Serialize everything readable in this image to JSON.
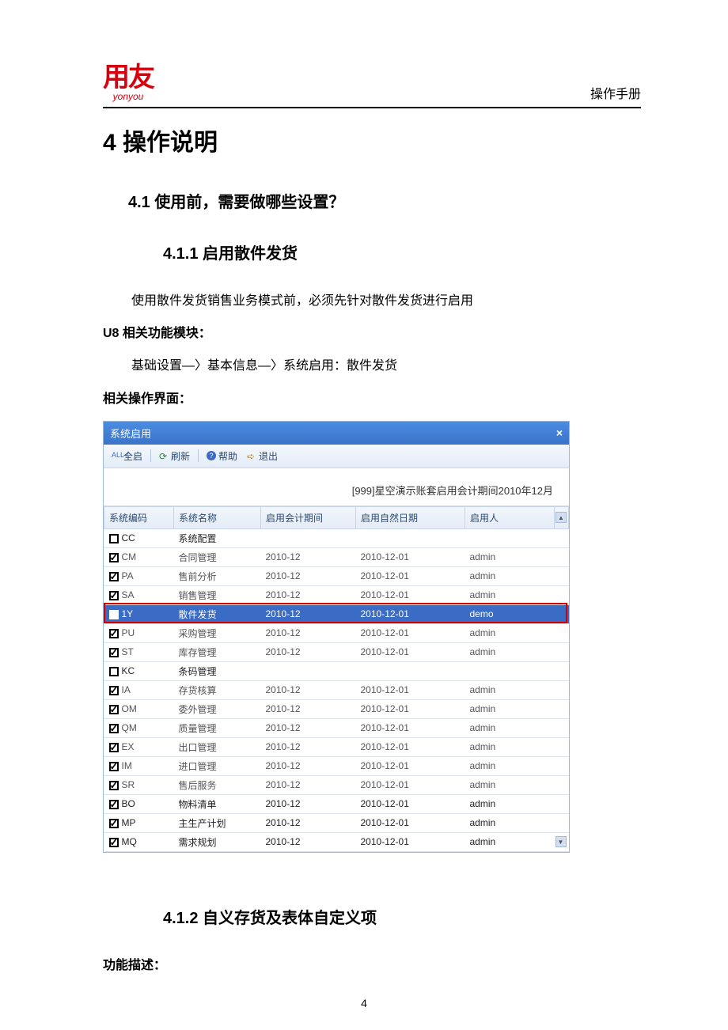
{
  "header": {
    "logo_cn": "用友",
    "logo_en": "yonyou",
    "manual_label": "操作手册"
  },
  "h1": "4 操作说明",
  "h2": "4.1 使用前，需要做哪些设置？",
  "h3_1": "4.1.1  启用散件发货",
  "p1": "使用散件发货销售业务模式前，必须先针对散件发货进行启用",
  "p2_label": "U8 相关功能模块：",
  "p2": "基础设置—〉基本信息—〉系统启用：散件发货",
  "p3_label": "相关操作界面：",
  "window": {
    "title": "系统启用",
    "toolbar": {
      "all": "全启",
      "refresh": "刷新",
      "help": "帮助",
      "exit": "退出"
    },
    "info": "[999]星空演示账套启用会计期间2010年12月",
    "columns": {
      "code": "系统编码",
      "name": "系统名称",
      "period": "启用会计期间",
      "date": "启用自然日期",
      "user": "启用人"
    },
    "rows": [
      {
        "chk": false,
        "code": "CC",
        "name": "系统配置",
        "period": "",
        "date": "",
        "user": "",
        "dark": true
      },
      {
        "chk": true,
        "code": "CM",
        "name": "合同管理",
        "period": "2010-12",
        "date": "2010-12-01",
        "user": "admin"
      },
      {
        "chk": true,
        "code": "PA",
        "name": "售前分析",
        "period": "2010-12",
        "date": "2010-12-01",
        "user": "admin"
      },
      {
        "chk": true,
        "code": "SA",
        "name": "销售管理",
        "period": "2010-12",
        "date": "2010-12-01",
        "user": "admin"
      },
      {
        "chk": true,
        "code": "1Y",
        "name": "散件发货",
        "period": "2010-12",
        "date": "2010-12-01",
        "user": "demo",
        "hi": true
      },
      {
        "chk": true,
        "code": "PU",
        "name": "采购管理",
        "period": "2010-12",
        "date": "2010-12-01",
        "user": "admin"
      },
      {
        "chk": true,
        "code": "ST",
        "name": "库存管理",
        "period": "2010-12",
        "date": "2010-12-01",
        "user": "admin"
      },
      {
        "chk": false,
        "code": "KC",
        "name": "条码管理",
        "period": "",
        "date": "",
        "user": "",
        "dark": true
      },
      {
        "chk": true,
        "code": "IA",
        "name": "存货核算",
        "period": "2010-12",
        "date": "2010-12-01",
        "user": "admin"
      },
      {
        "chk": true,
        "code": "OM",
        "name": "委外管理",
        "period": "2010-12",
        "date": "2010-12-01",
        "user": "admin"
      },
      {
        "chk": true,
        "code": "QM",
        "name": "质量管理",
        "period": "2010-12",
        "date": "2010-12-01",
        "user": "admin"
      },
      {
        "chk": true,
        "code": "EX",
        "name": "出口管理",
        "period": "2010-12",
        "date": "2010-12-01",
        "user": "admin"
      },
      {
        "chk": true,
        "code": "IM",
        "name": "进口管理",
        "period": "2010-12",
        "date": "2010-12-01",
        "user": "admin"
      },
      {
        "chk": true,
        "code": "SR",
        "name": "售后服务",
        "period": "2010-12",
        "date": "2010-12-01",
        "user": "admin"
      },
      {
        "chk": true,
        "code": "BO",
        "name": "物料清单",
        "period": "2010-12",
        "date": "2010-12-01",
        "user": "admin",
        "dark": true
      },
      {
        "chk": true,
        "code": "MP",
        "name": "主生产计划",
        "period": "2010-12",
        "date": "2010-12-01",
        "user": "admin",
        "dark": true
      },
      {
        "chk": true,
        "code": "MQ",
        "name": "需求规划",
        "period": "2010-12",
        "date": "2010-12-01",
        "user": "admin",
        "dark": true
      }
    ]
  },
  "h3_2": "4.1.2  自义存货及表体自定义项",
  "p4_label": "功能描述：",
  "page_number": "4"
}
